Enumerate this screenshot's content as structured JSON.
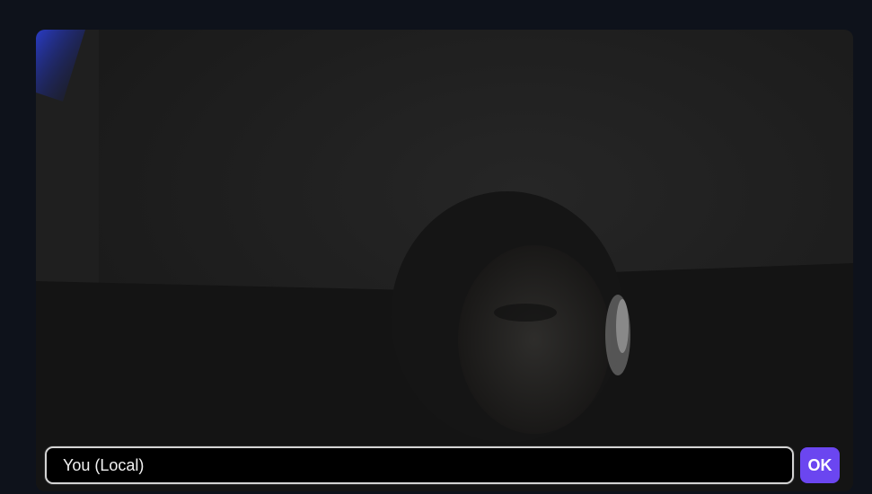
{
  "video": {
    "description_icon": "local-camera-feed",
    "accent_color": "#6b46f0"
  },
  "name_field": {
    "value": "You (Local)",
    "placeholder": ""
  },
  "ok_button": {
    "label": "OK"
  }
}
